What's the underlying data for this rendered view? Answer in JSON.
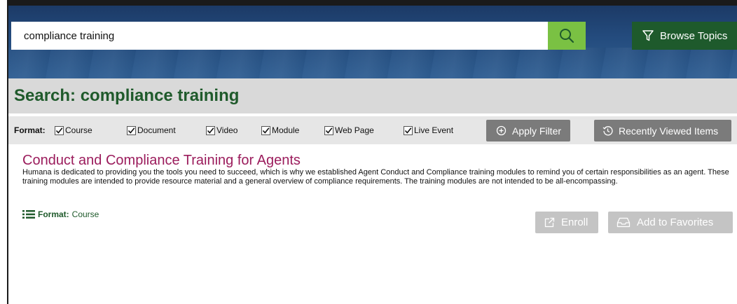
{
  "search": {
    "query": "compliance training",
    "button_icon": "search-icon"
  },
  "browse": {
    "label": "Browse Topics",
    "icon": "filter-funnel-icon"
  },
  "page": {
    "title": "Search: compliance training"
  },
  "filters": {
    "label": "Format:",
    "options": [
      {
        "label": "Course",
        "checked": true
      },
      {
        "label": "Document",
        "checked": true
      },
      {
        "label": "Video",
        "checked": true
      },
      {
        "label": "Module",
        "checked": true
      },
      {
        "label": "Web Page",
        "checked": true
      },
      {
        "label": "Live Event",
        "checked": true
      }
    ],
    "apply_label": "Apply Filter",
    "recent_label": "Recently Viewed Items"
  },
  "results": [
    {
      "title": "Conduct and Compliance Training for Agents",
      "description": "Humana is dedicated to providing you the tools you need to succeed, which is why we established Agent Conduct and Compliance training modules to remind you of certain responsibilities as an agent. These training modules are intended to provide resource material and a general overview of compliance requirements. The training modules are not intended to be all-encompassing.",
      "format_label": "Format:",
      "format_value": "Course",
      "enroll_label": "Enroll",
      "favorites_label": "Add to Favorites"
    }
  ],
  "colors": {
    "banner": "#234a7c",
    "search_green": "#7ac143",
    "dark_green": "#1e5a2c",
    "title_green": "#1f5a2b",
    "result_title": "#9b1c5c",
    "gray_button": "#7b7b7b",
    "light_gray_button": "#c4c4c4"
  }
}
